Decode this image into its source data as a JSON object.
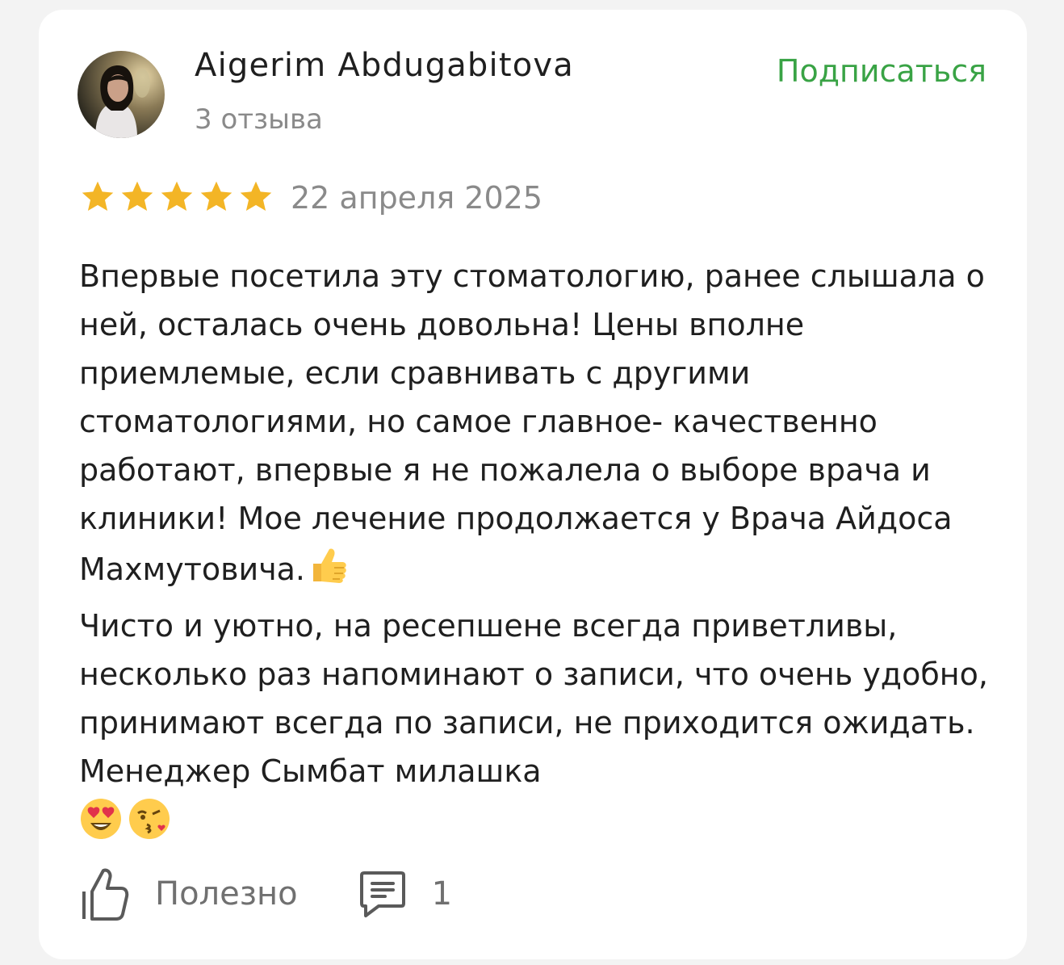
{
  "author": {
    "name": "Aigerim Abdugabitova",
    "reviews_count": "3 отзыва",
    "avatar_icon": "user-photo"
  },
  "subscribe_label": "Подписаться",
  "colors": {
    "accent_green": "#39a345",
    "star_gold": "#f3b526",
    "muted_text": "#8a8a8a",
    "primary_text": "#1f1f1f"
  },
  "rating": {
    "value": 5,
    "max": 5
  },
  "date": "22 апреля 2025",
  "review": {
    "paragraph1": "Впервые посетила эту стоматологию, ранее слышала о ней, осталась очень довольна! Цены вполне приемлемые, если сравнивать с другими стоматологиями, но самое главное- качественно работают, впервые я не пожалела о выборе врача и клиники! Мое лечение продолжается у Врача Айдоса Махмутовича.",
    "paragraph1_emoji": "thumbs-up-emoji",
    "paragraph2": "Чисто и уютно, на ресепшене всегда приветливы, несколько раз напоминают о записи, что очень удобно, принимают всегда по записи, не приходится ожидать. Менеджер Сымбат милашка",
    "paragraph2_emojis": [
      "heart-eyes-emoji",
      "kissing-face-emoji"
    ]
  },
  "footer": {
    "useful_label": "Полезно",
    "useful_icon": "thumbs-up-icon",
    "comments_icon": "comment-icon",
    "comments_count": "1"
  }
}
